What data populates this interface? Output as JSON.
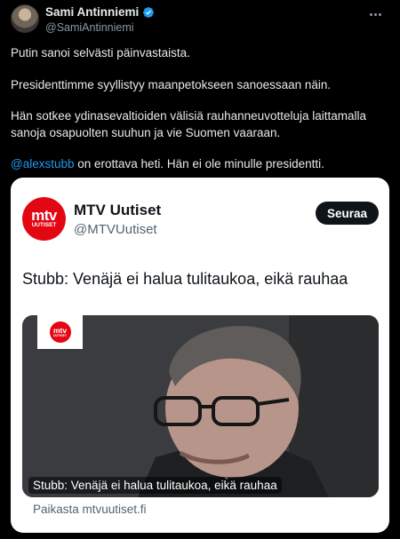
{
  "author": {
    "display_name": "Sami Antinniemi",
    "handle": "@SamiAntinniemi",
    "verified": true
  },
  "tweet": {
    "paragraph1": "Putin sanoi selvästi päinvastaista.",
    "paragraph2": "Presidenttimme syyllistyy maanpetokseen sanoessaan näin.",
    "paragraph3_line1": "Hän sotkee ydinasevaltioiden välisiä rauhanneuvotteluja laittamalla",
    "paragraph3_line2": "sanoja osapuolten suuhun ja vie Suomen vaaraan.",
    "mention": "@alexstubb",
    "paragraph4_rest": " on erottava heti. Hän ei ole minulle presidentti."
  },
  "quote": {
    "logo_line1": "mtv",
    "logo_line2": "UUTISET",
    "name": "MTV Uutiset",
    "handle": "@MTVUutiset",
    "follow_label": "Seuraa",
    "text": "Stubb: Venäjä ei halua tulitaukoa, eikä rauhaa",
    "media_logo_line1": "mtv",
    "media_logo_line2": "UUTISET",
    "media_caption": "Stubb: Venäjä ei halua tulitaukoa, eikä rauhaa",
    "source": "Paikasta mtvuutiset.fi"
  },
  "icons": {
    "verified": "verified-badge-icon",
    "more": "more-horizontal-icon"
  },
  "colors": {
    "background": "#000000",
    "link": "#1d9bf0",
    "brand_red": "#e30613",
    "verified_blue": "#1d9bf0"
  }
}
